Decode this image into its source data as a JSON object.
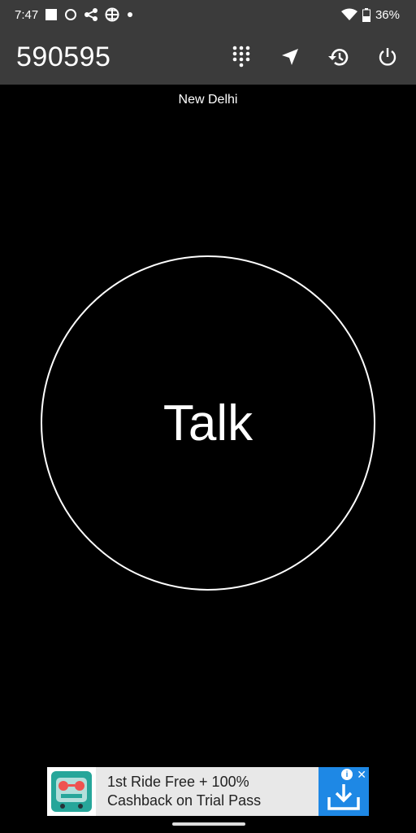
{
  "status_bar": {
    "time": "7:47",
    "battery": "36%",
    "icons": [
      "square-notification-icon",
      "circle-notification-icon",
      "share-icon",
      "grid-globe-icon",
      "dot-icon",
      "wifi-icon",
      "battery-icon"
    ]
  },
  "app_bar": {
    "title": "590595",
    "actions": [
      "dialpad-icon",
      "navigation-arrow-icon",
      "history-icon",
      "power-icon"
    ]
  },
  "location": "New Delhi",
  "talk_button": {
    "label": "Talk"
  },
  "ad": {
    "line1": "1st Ride Free + 100%",
    "line2": "Cashback on Trial Pass",
    "info": "i",
    "close": "✕"
  },
  "colors": {
    "bar_bg": "#3b3b3b",
    "background": "#000000",
    "ad_accent": "#1e88e5"
  }
}
